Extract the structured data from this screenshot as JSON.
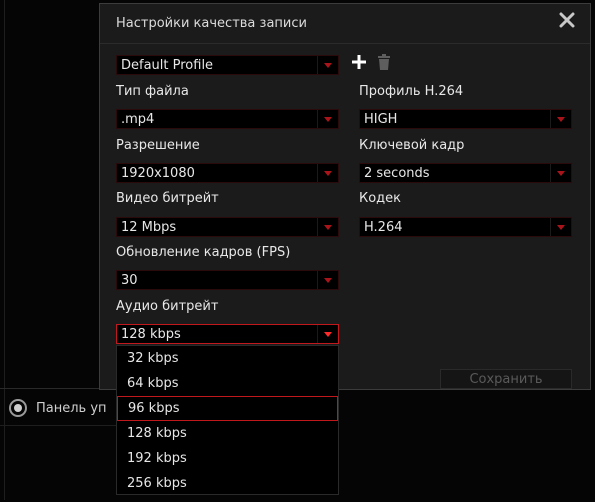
{
  "background": {
    "panel_label": "Панель уп"
  },
  "dialog": {
    "title": "Настройки качества записи",
    "profile": {
      "value": "Default Profile"
    },
    "file_type": {
      "label": "Тип файла",
      "value": ".mp4"
    },
    "resolution": {
      "label": "Разрешение",
      "value": "1920x1080"
    },
    "video_bitrate": {
      "label": "Видео битрейт",
      "value": "12 Mbps"
    },
    "fps": {
      "label": "Обновление кадров (FPS)",
      "value": "30"
    },
    "audio_bitrate": {
      "label": "Аудио битрейт",
      "value": "128 kbps"
    },
    "h264_profile": {
      "label": "Профиль H.264",
      "value": "HIGH"
    },
    "keyframe": {
      "label": "Ключевой кадр",
      "value": "2 seconds"
    },
    "codec": {
      "label": "Кодек",
      "value": "H.264"
    },
    "save_label": "Сохранить"
  },
  "audio_dropdown": {
    "options": [
      "32 kbps",
      "64 kbps",
      "96 kbps",
      "128 kbps",
      "192 kbps",
      "256 kbps"
    ],
    "highlighted": "96 kbps"
  },
  "colors": {
    "accent": "#c0181c",
    "dialog_bg": "#1b1b1b",
    "field_bg": "#000000"
  },
  "icons": [
    "close-icon",
    "plus-icon",
    "trash-icon",
    "dropdown-arrow-icon",
    "camera-ring-icon"
  ]
}
